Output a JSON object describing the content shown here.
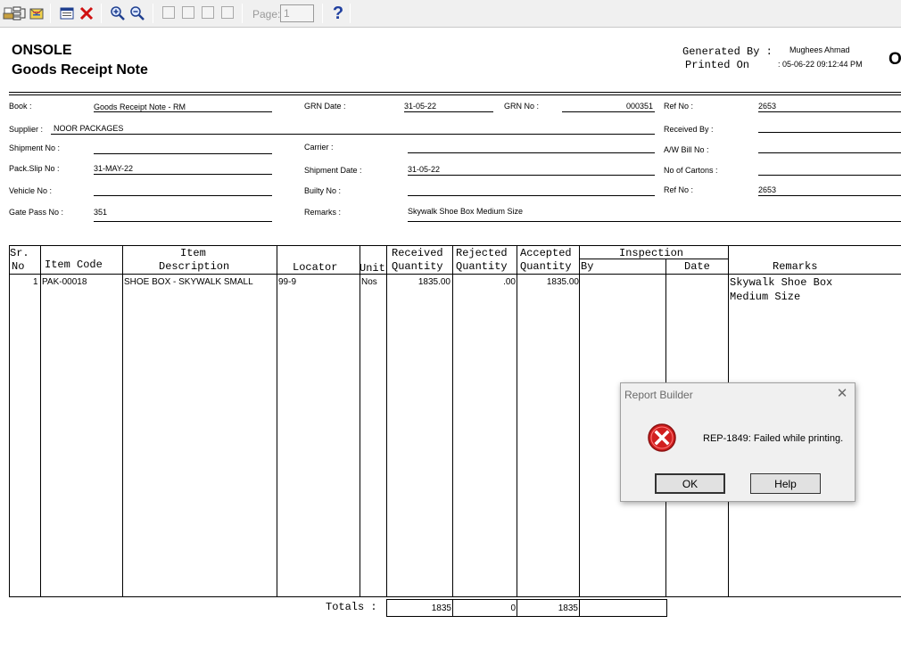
{
  "toolbar": {
    "page_label": "Page:",
    "page_value": "1",
    "help_glyph": "?"
  },
  "report": {
    "company": "ONSOLE",
    "title": "Goods Receipt Note",
    "generated_by_label": "Generated By :",
    "generated_by_value": "Mughees Ahmad",
    "printed_on_label": "Printed On",
    "printed_on_value": ": 05-06-22  09:12:44 PM",
    "corner_text": "OT"
  },
  "fields": {
    "book_label": "Book :",
    "book_value": "Goods Receipt Note - RM",
    "grn_date_label": "GRN Date :",
    "grn_date_value": "31-05-22",
    "grn_no_label": "GRN No :",
    "grn_no_value": "000351",
    "ref_no_label": "Ref No :",
    "ref_no_value": "2653",
    "supplier_label": "Supplier :",
    "supplier_value": "NOOR PACKAGES",
    "received_by_label": "Received By :",
    "shipment_no_label": "Shipment No :",
    "carrier_label": "Carrier :",
    "aw_bill_label": "A/W Bill No :",
    "pack_slip_label": "Pack.Slip No :",
    "pack_slip_value": "31-MAY-22",
    "shipment_date_label": "Shipment Date :",
    "shipment_date_value": "31-05-22",
    "cartons_label": "No of Cartons :",
    "vehicle_label": "Vehicle No :",
    "builty_label": "Builty No :",
    "ref_no2_label": "Ref No :",
    "ref_no2_value": "2653",
    "gate_pass_label": "Gate Pass No :",
    "gate_pass_value": "351",
    "remarks_label": "Remarks :",
    "remarks_value": "Skywalk Shoe Box Medium Size"
  },
  "table": {
    "headers": {
      "sr_1": "Sr.",
      "sr_2": "No",
      "item_code": "Item Code",
      "item_desc_1": "Item",
      "item_desc_2": "Description",
      "locator": "Locator",
      "unit": "Unit",
      "received_1": "Received",
      "received_2": "Quantity",
      "rejected_1": "Rejected",
      "rejected_2": "Quantity",
      "accepted_1": "Accepted",
      "accepted_2": "Quantity",
      "inspection": "Inspection",
      "by": "By",
      "date": "Date",
      "remarks": "Remarks"
    },
    "rows": [
      {
        "sr": "1",
        "item_code": "PAK-00018",
        "description": "SHOE BOX - SKYWALK SMALL",
        "locator": "99-9",
        "unit": "Nos",
        "received": "1835.00",
        "rejected": ".00",
        "accepted": "1835.00",
        "remarks_1": "Skywalk Shoe Box",
        "remarks_2": "Medium Size"
      }
    ],
    "totals": {
      "label": "Totals :",
      "received": "1835",
      "rejected": "0",
      "accepted": "1835"
    }
  },
  "dialog": {
    "title": "Report Builder",
    "close_glyph": "✕",
    "message": "REP-1849: Failed while printing.",
    "ok_label": "OK",
    "help_label": "Help",
    "error_color": "#d11f1f"
  }
}
